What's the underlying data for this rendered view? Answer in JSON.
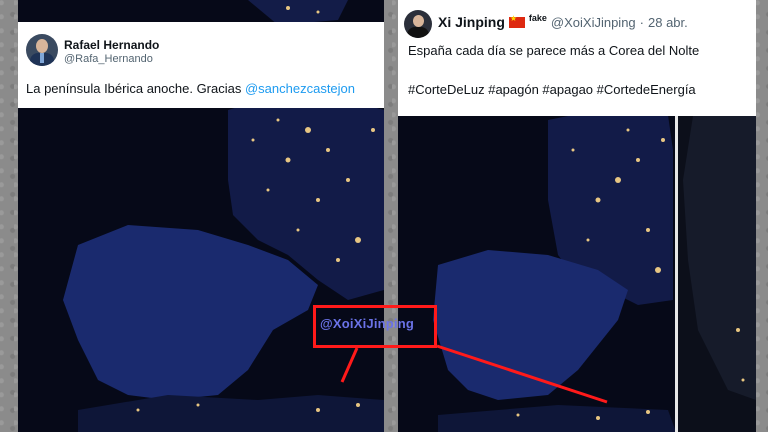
{
  "left_tweet": {
    "name": "Rafael Hernando",
    "handle": "@Rafa_Hernando",
    "text": "La península Ibérica anoche. Gracias ",
    "mention": "@sanchezcastejon"
  },
  "right_tweet": {
    "name": "Xi Jinping",
    "fake_label": "fake",
    "handle": "@XoiXiJinping",
    "separator": "·",
    "date": "28 abr.",
    "text": "España cada día se parece más a Corea del Nolte",
    "hashtags": "#CorteDeLuz #apagón #apagao #CortedeEnergía"
  },
  "highlight": {
    "watermark": "@XoiXiJinping",
    "box_color": "#ff1a1a",
    "watermark_color": "#6b73e8"
  },
  "colors": {
    "night_sea": "#070a1c",
    "land": "#101c4c",
    "city_light": "#ffd98a",
    "link": "#1d9bf0"
  }
}
